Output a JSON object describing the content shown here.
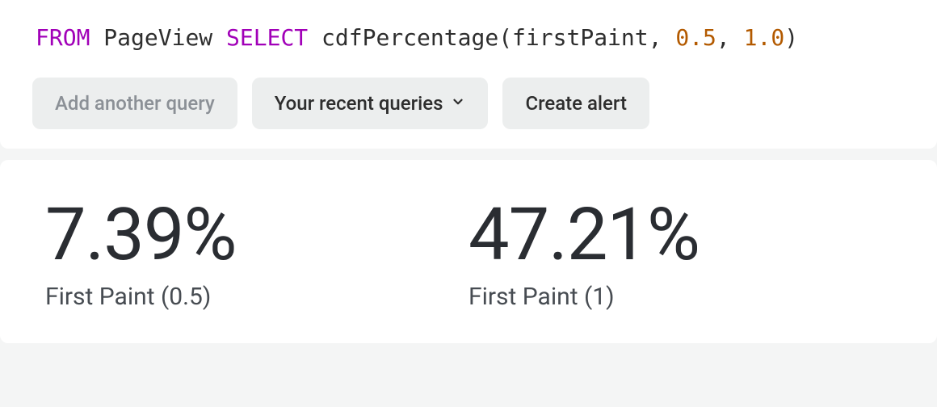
{
  "query": {
    "tokens": [
      {
        "kind": "keyword",
        "text": "FROM"
      },
      {
        "kind": "space",
        "text": " "
      },
      {
        "kind": "ident",
        "text": "PageView"
      },
      {
        "kind": "space",
        "text": " "
      },
      {
        "kind": "keyword",
        "text": "SELECT"
      },
      {
        "kind": "space",
        "text": " "
      },
      {
        "kind": "ident",
        "text": "cdfPercentage"
      },
      {
        "kind": "punct",
        "text": "("
      },
      {
        "kind": "ident",
        "text": "firstPaint"
      },
      {
        "kind": "punct",
        "text": ","
      },
      {
        "kind": "space",
        "text": " "
      },
      {
        "kind": "number",
        "text": "0.5"
      },
      {
        "kind": "punct",
        "text": ","
      },
      {
        "kind": "space",
        "text": " "
      },
      {
        "kind": "number",
        "text": "1.0"
      },
      {
        "kind": "punct",
        "text": ")"
      }
    ]
  },
  "toolbar": {
    "add_query_label": "Add another query",
    "recent_queries_label": "Your recent queries",
    "create_alert_label": "Create alert"
  },
  "results": [
    {
      "value": "7.39%",
      "label": "First Paint (0.5)"
    },
    {
      "value": "47.21%",
      "label": "First Paint (1)"
    }
  ],
  "chart_data": {
    "type": "table",
    "title": "cdfPercentage(firstPaint, 0.5, 1.0)",
    "series": [
      {
        "name": "First Paint (0.5)",
        "value": 7.39,
        "unit": "%"
      },
      {
        "name": "First Paint (1)",
        "value": 47.21,
        "unit": "%"
      }
    ]
  }
}
